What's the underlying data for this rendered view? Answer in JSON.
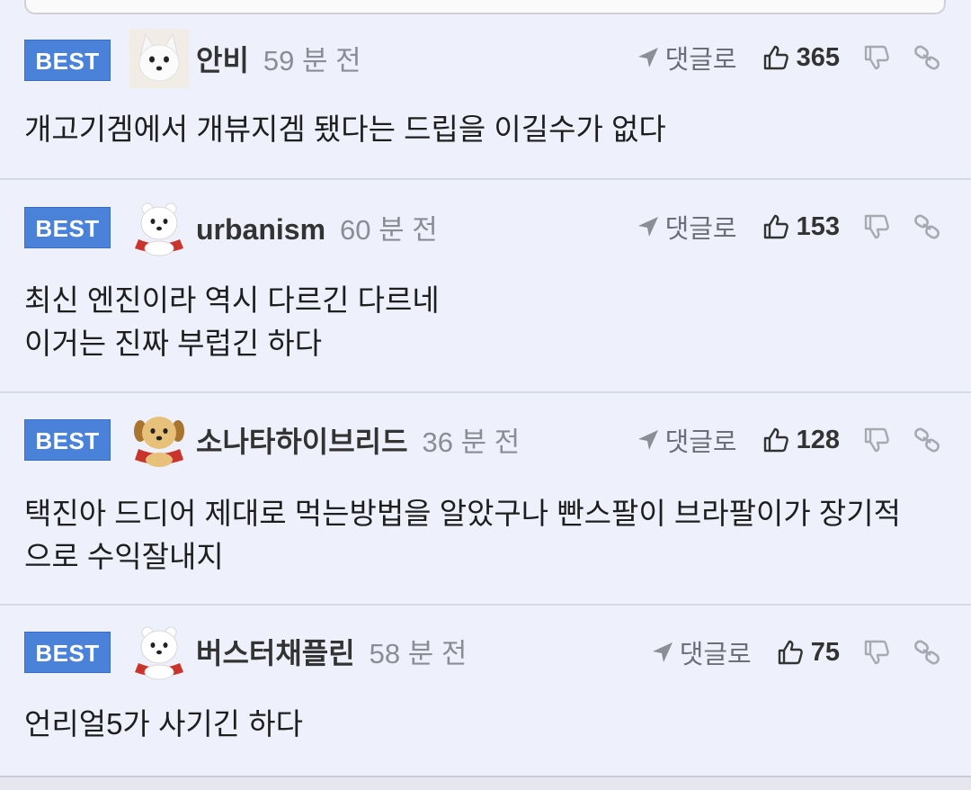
{
  "comments": [
    {
      "badge": "BEST",
      "avatar_icon": "white-fox-avatar",
      "username": "안비",
      "time": "59 분 전",
      "reply_label": "댓글로",
      "likes": "365",
      "body": "개고기겜에서 개뷰지겜 됐다는 드립을 이길수가 없다"
    },
    {
      "badge": "BEST",
      "avatar_icon": "polar-bear-avatar",
      "username": "urbanism",
      "time": "60 분 전",
      "reply_label": "댓글로",
      "likes": "153",
      "body": "최신 엔진이라 역시 다르긴 다르네\n이거는 진짜 부럽긴 하다"
    },
    {
      "badge": "BEST",
      "avatar_icon": "puppy-avatar",
      "username": "소나타하이브리드",
      "time": "36 분 전",
      "reply_label": "댓글로",
      "likes": "128",
      "body": "택진아 드디어 제대로 먹는방법을 알았구나 빤스팔이 브라팔이가 장기적\n으로 수익잘내지"
    },
    {
      "badge": "BEST",
      "avatar_icon": "polar-bear-avatar",
      "username": "버스터채플린",
      "time": "58 분 전",
      "reply_label": "댓글로",
      "likes": "75",
      "body": "언리얼5가 사기긴 하다"
    }
  ],
  "colors": {
    "background": "#eef0fb",
    "badge": "#4b82d9",
    "time": "#8a8d96"
  }
}
